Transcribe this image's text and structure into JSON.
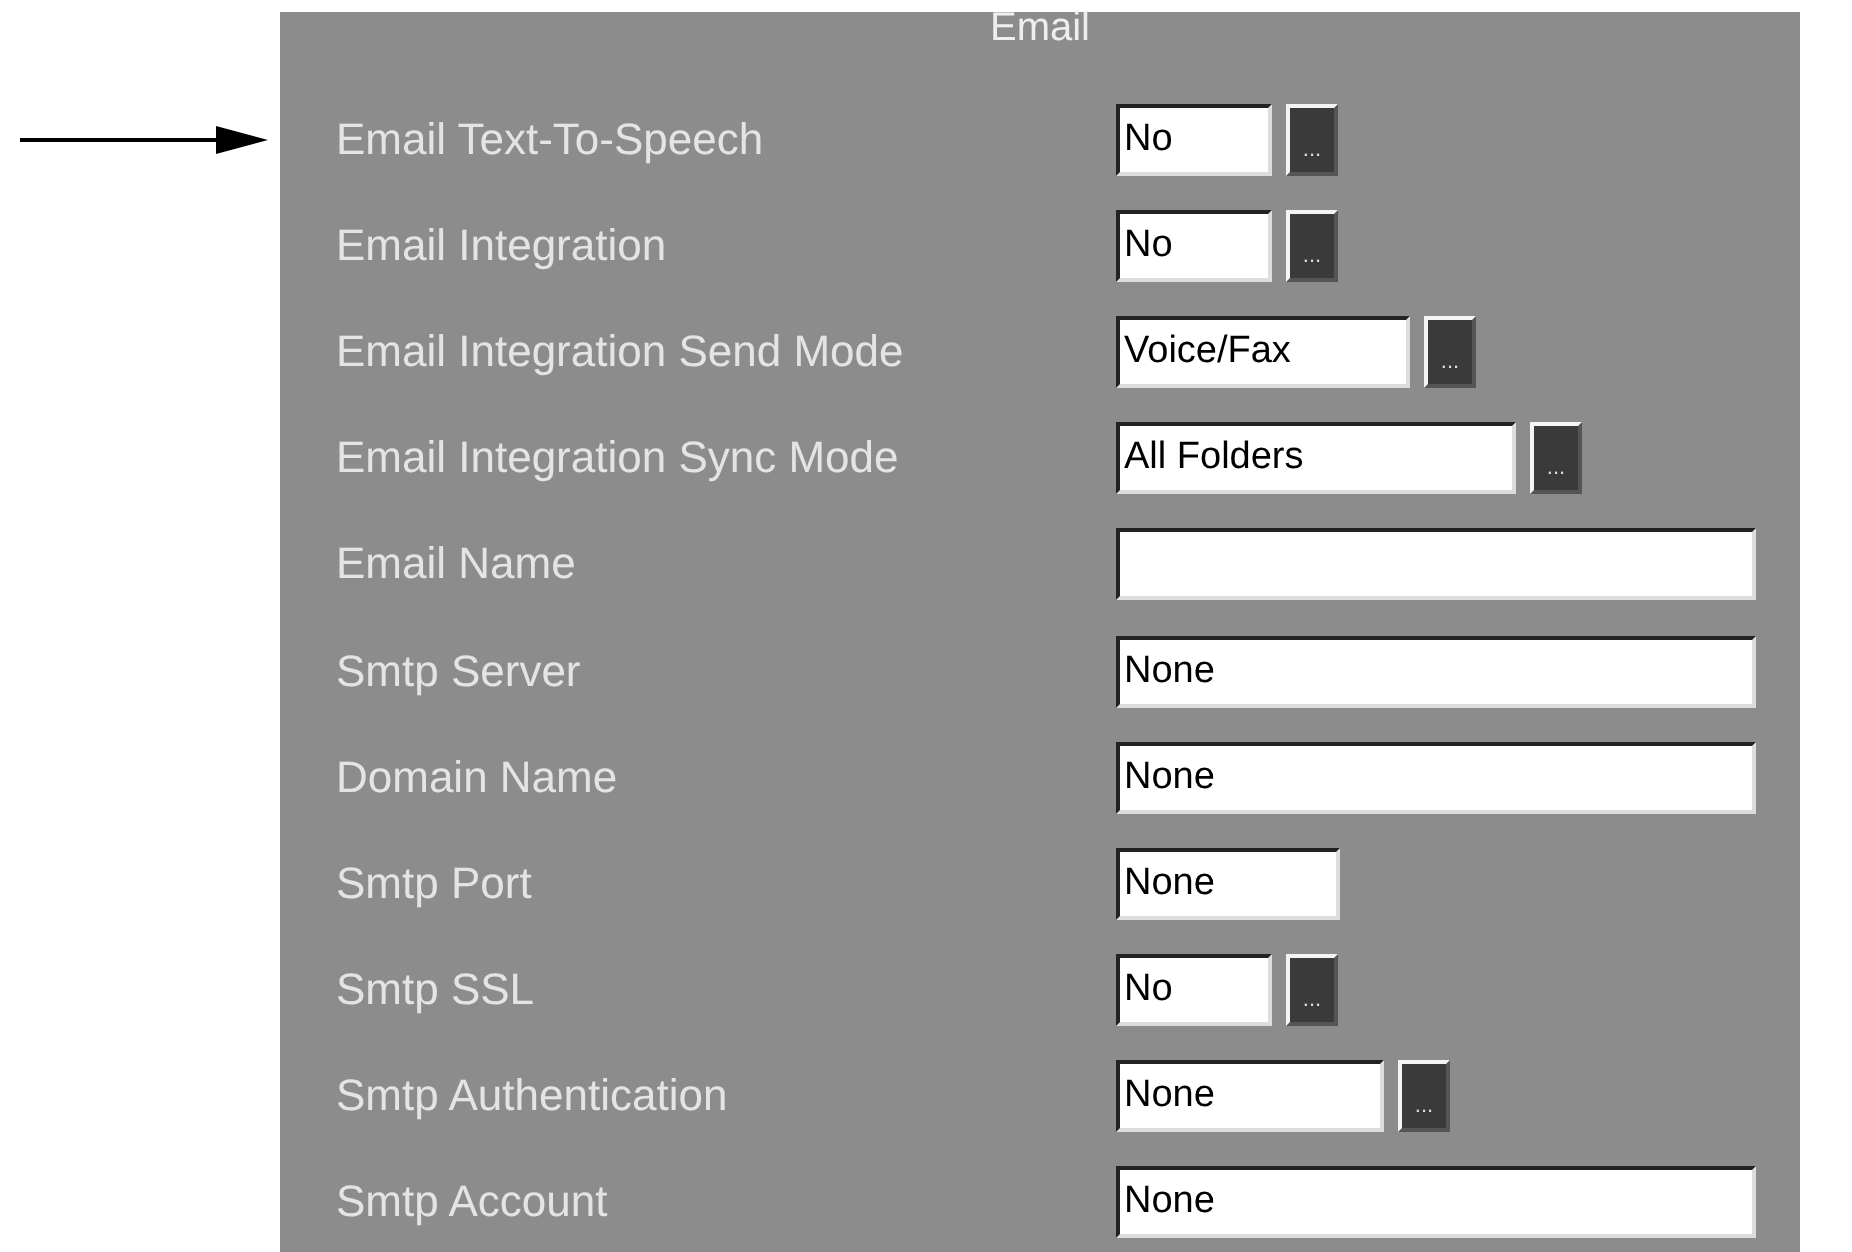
{
  "panel": {
    "title": "Email"
  },
  "rows": [
    {
      "label": "Email Text-To-Speech",
      "kind": "choice",
      "value": "No",
      "button": "..."
    },
    {
      "label": "Email Integration",
      "kind": "choice",
      "value": "No",
      "button": "..."
    },
    {
      "label": "Email Integration Send Mode",
      "kind": "choice",
      "value": "Voice/Fax",
      "button": "..."
    },
    {
      "label": "Email Integration Sync Mode",
      "kind": "choice",
      "value": "All Folders",
      "button": "..."
    },
    {
      "label": "Email Name",
      "kind": "text"
    },
    {
      "label": "Smtp Server",
      "kind": "text",
      "value": "None"
    },
    {
      "label": "Domain Name",
      "kind": "text",
      "value": "None"
    },
    {
      "label": "Smtp Port",
      "kind": "text",
      "value": "None"
    },
    {
      "label": "Smtp SSL",
      "kind": "choice",
      "value": "No",
      "button": "..."
    },
    {
      "label": "Smtp Authentication",
      "kind": "choice",
      "value": "None",
      "button": "..."
    },
    {
      "label": "Smtp Account",
      "kind": "text",
      "value": "None"
    }
  ]
}
